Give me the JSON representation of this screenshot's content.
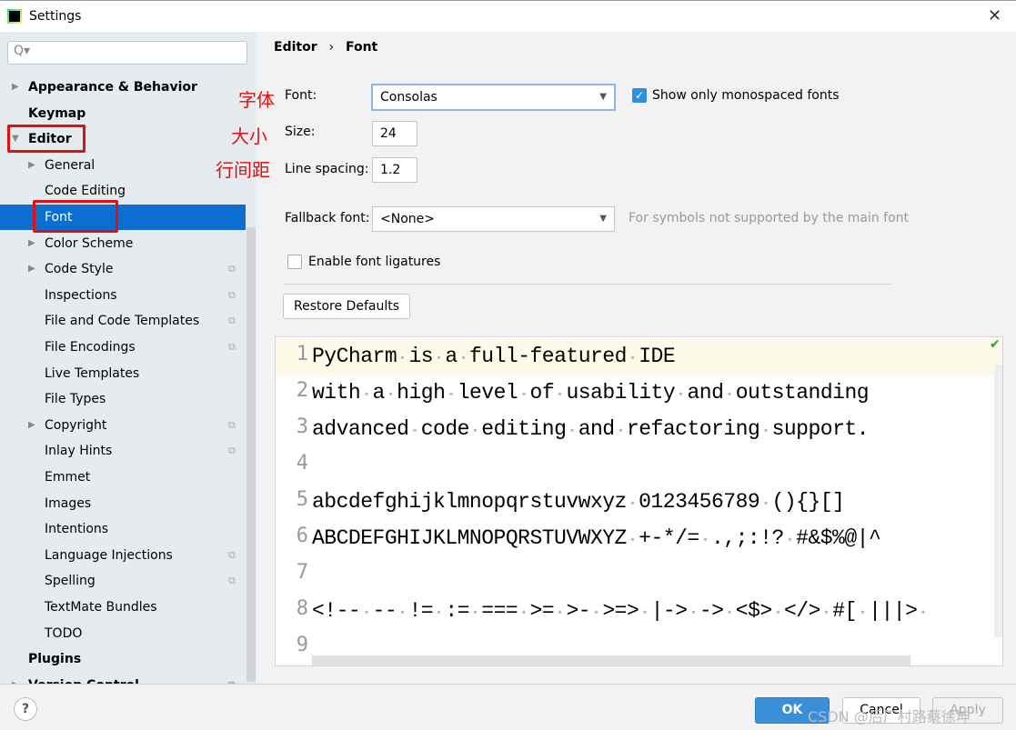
{
  "window": {
    "title": "Settings",
    "close_icon": "close-icon"
  },
  "sidebar": {
    "search_placeholder": "Q▾",
    "items": [
      {
        "label": "Appearance & Behavior",
        "bold": true,
        "arrow": "right",
        "level": 0
      },
      {
        "label": "Keymap",
        "bold": true,
        "level": 0
      },
      {
        "label": "Editor",
        "bold": true,
        "arrow": "down",
        "level": 0
      },
      {
        "label": "General",
        "arrow": "right",
        "level": 1
      },
      {
        "label": "Code Editing",
        "level": 1
      },
      {
        "label": "Font",
        "level": 1,
        "selected": true
      },
      {
        "label": "Color Scheme",
        "arrow": "right",
        "level": 1
      },
      {
        "label": "Code Style",
        "arrow": "right",
        "level": 1,
        "badge": true
      },
      {
        "label": "Inspections",
        "level": 1,
        "badge": true
      },
      {
        "label": "File and Code Templates",
        "level": 1,
        "badge": true
      },
      {
        "label": "File Encodings",
        "level": 1,
        "badge": true
      },
      {
        "label": "Live Templates",
        "level": 1
      },
      {
        "label": "File Types",
        "level": 1
      },
      {
        "label": "Copyright",
        "arrow": "right",
        "level": 1,
        "badge": true
      },
      {
        "label": "Inlay Hints",
        "level": 1,
        "badge": true
      },
      {
        "label": "Emmet",
        "level": 1
      },
      {
        "label": "Images",
        "level": 1
      },
      {
        "label": "Intentions",
        "level": 1
      },
      {
        "label": "Language Injections",
        "level": 1,
        "badge": true
      },
      {
        "label": "Spelling",
        "level": 1,
        "badge": true
      },
      {
        "label": "TextMate Bundles",
        "level": 1
      },
      {
        "label": "TODO",
        "level": 1
      },
      {
        "label": "Plugins",
        "bold": true,
        "level": 0
      },
      {
        "label": "Version Control",
        "bold": true,
        "arrow": "right",
        "level": 0,
        "badge": true
      }
    ]
  },
  "annotations": {
    "font": "字体",
    "size": "大小",
    "line_spacing": "行间距",
    "color": "#e01010"
  },
  "breadcrumb": {
    "parent": "Editor",
    "separator": "›",
    "current": "Font"
  },
  "form": {
    "font_label": "Font:",
    "font_value": "Consolas",
    "mono_label": "Show only monospaced fonts",
    "mono_checked": true,
    "size_label": "Size:",
    "size_value": "24",
    "spacing_label": "Line spacing:",
    "spacing_value": "1.2",
    "fallback_label": "Fallback font:",
    "fallback_value": "<None>",
    "fallback_hint": "For symbols not supported by the main font",
    "ligatures_label": "Enable font ligatures",
    "ligatures_checked": false,
    "restore_label": "Restore Defaults"
  },
  "preview": {
    "lines": [
      "PyCharm is a full-featured IDE",
      "with a high level of usability and outstanding",
      "advanced code editing and refactoring support.",
      "",
      "abcdefghijklmnopqrstuvwxyz 0123456789 (){}[]",
      "ABCDEFGHIJKLMNOPQRSTUVWXYZ +-*/= .,;:!? #&$%@|^",
      "",
      "<!-- -- != := === >= >- >=> |-> -> <$> </> #[ |||> ",
      ""
    ]
  },
  "footer": {
    "help": "?",
    "ok": "OK",
    "cancel": "Cancel",
    "apply": "Apply",
    "watermark": "CSDN @后厂村路蔡徐坤",
    "accent": "#3a8fd9"
  }
}
